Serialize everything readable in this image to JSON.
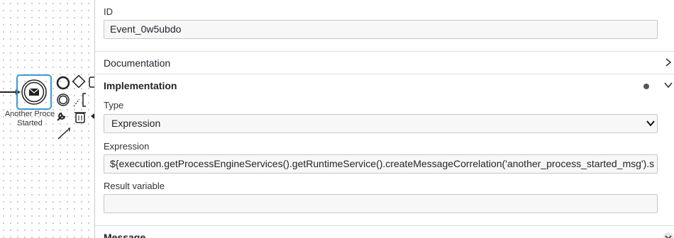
{
  "canvas": {
    "element_label": [
      "Another Proce",
      "Started"
    ]
  },
  "panel": {
    "id_label": "ID",
    "id_value": "Event_0w5ubdo",
    "documentation": "Documentation",
    "implementation": "Implementation",
    "type_label": "Type",
    "type_value": "Expression",
    "expression_label": "Expression",
    "expression_value": "${execution.getProcessEngineServices().getRuntimeService().createMessageCorrelation('another_process_started_msg').s",
    "result_label": "Result variable",
    "result_value": "",
    "message": "Message"
  },
  "colors": {
    "selection": "#3e9bd6",
    "accent_dot": "#505562"
  }
}
